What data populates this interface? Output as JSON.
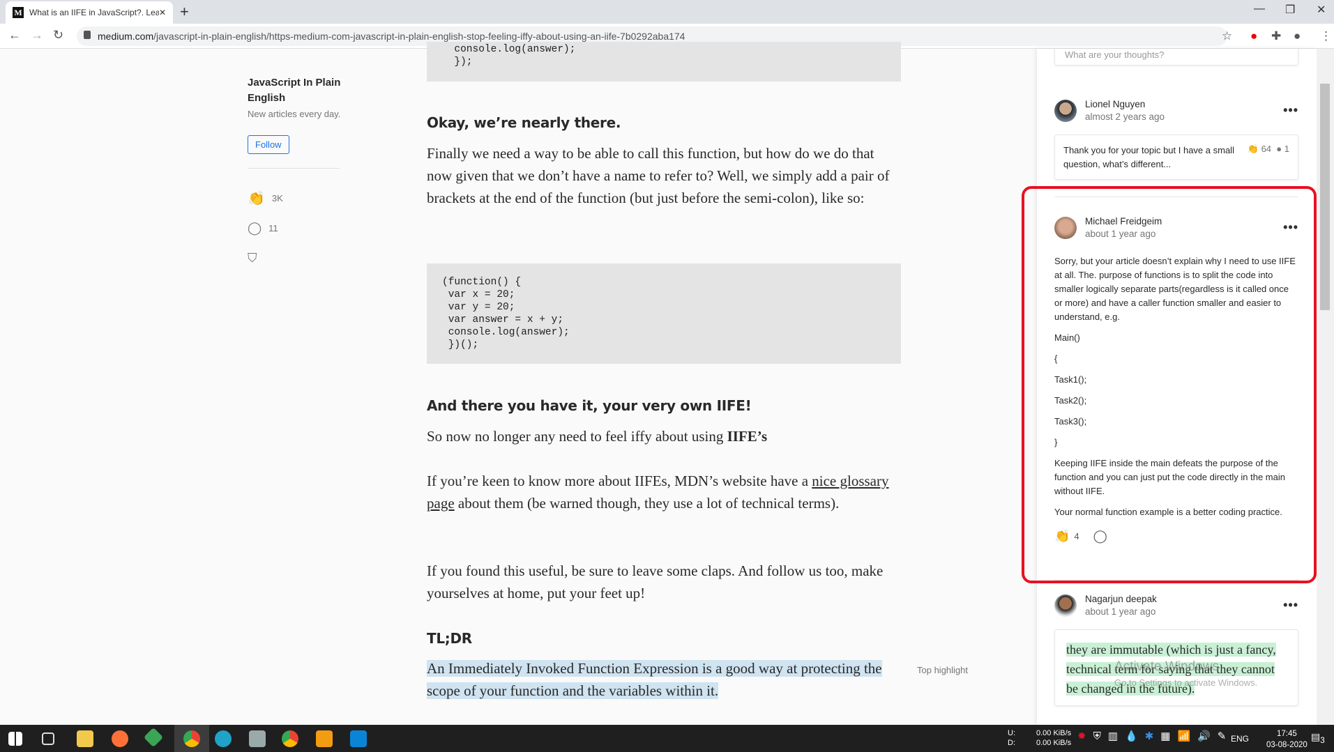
{
  "browser": {
    "tab_title": "What is an IIFE in JavaScript?. Lea",
    "tab_favicon": "M",
    "url_domain": "medium.com",
    "url_path": "/javascript-in-plain-english/https-medium-com-javascript-in-plain-english-stop-feeling-iffy-about-using-an-iife-7b0292aba174"
  },
  "sidebar": {
    "publication": "JavaScript In Plain English",
    "description": "New articles every day.",
    "follow_label": "Follow",
    "claps": "3K",
    "responses": "11"
  },
  "article": {
    "code_top": "  console.log(answer);\n  });",
    "h1": "Okay, we’re nearly there.",
    "p1": "Finally we need a way to be able to call this function, but how do we do that now given that we don’t have a name to refer to? Well, we simply add a pair of brackets at the end of the function (but just before the semi-colon), like so:",
    "code2": "(function() {\n var x = 20;\n var y = 20;\n var answer = x + y;\n console.log(answer);\n })();",
    "h2": "And there you have it, your very own IIFE!",
    "p2a": "So now no longer any need to feel iffy about using ",
    "p2b": "IIFE’s",
    ".": ".",
    "p3a": "If you’re keen to know more about IIFEs, MDN’s website have a ",
    "p3link": "nice glossary page",
    "p3b": " about them (be warned though, they use a lot of technical terms).",
    "p4": "If you found this useful, be sure to leave some claps. And follow us too, make yourselves at home, put your feet up!",
    "h3": "TL;DR",
    "p5": "An Immediately Invoked Function Expression is a good way at protecting the scope of your function and the variables within it.",
    "top_highlight": "Top highlight"
  },
  "responses": {
    "placeholder": "What are your thoughts?",
    "items": [
      {
        "name": "Lionel Nguyen",
        "time": "almost 2 years ago",
        "text": "Thank you for your topic but I have a small question, what’s different...",
        "claps": "64",
        "replies": "1"
      },
      {
        "name": "Michael Freidgeim",
        "time": "about 1 year ago",
        "paragraphs": [
          "Sorry, but your article doesn’t explain why I need to use IIFE at all. The. purpose of functions is to split the code into smaller logically separate parts(regardless is it called once or more) and have a caller function smaller and easier to understand, e.g.",
          "Main()",
          "{",
          "Task1();",
          "Task2();",
          "Task3();",
          "}",
          "Keeping IIFE inside the main defeats the purpose of the function and you can just put the code directly in the main without IIFE.",
          "Your normal function example is a better coding practice."
        ],
        "claps": "4"
      },
      {
        "name": "Nagarjun deepak",
        "time": "about 1 year ago",
        "text": "they are immutable (which is just a fancy, technical term for saying that they cannot be changed in the future)."
      }
    ]
  },
  "watermark": {
    "title": "Activate Windows",
    "sub": "Go to Settings to activate Windows."
  },
  "taskbar": {
    "up_label": "U:",
    "down_label": "D:",
    "up": "0.00 KiB/s",
    "down": "0.00 KiB/s",
    "lang": "ENG",
    "time": "17:45",
    "date": "03-08-2020",
    "notifications": "3"
  },
  "colors": {
    "annotation": "#e81123",
    "highlight": "#cfe3f0",
    "green_highlight": "#c9f0d5"
  }
}
